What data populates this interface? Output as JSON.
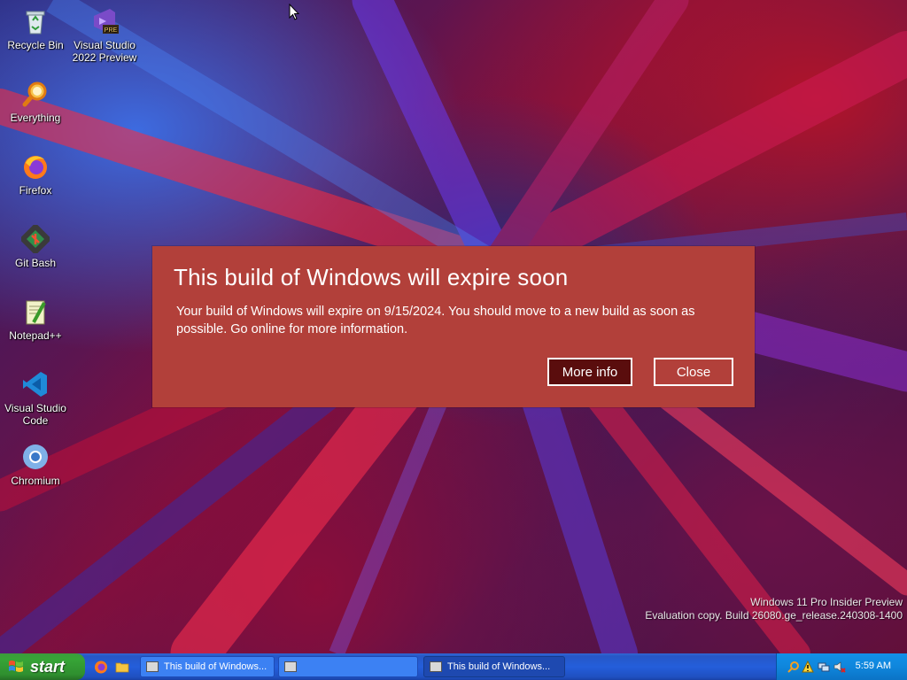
{
  "desktop": {
    "icons": [
      {
        "label": "Recycle Bin",
        "icon": "recycle-bin-icon"
      },
      {
        "label": "Visual Studio 2022 Preview",
        "icon": "visual-studio-preview-icon",
        "badge": "PRE"
      },
      {
        "label": "Everything",
        "icon": "everything-search-icon"
      },
      {
        "label": "Firefox",
        "icon": "firefox-icon"
      },
      {
        "label": "Git Bash",
        "icon": "git-bash-icon"
      },
      {
        "label": "Notepad++",
        "icon": "notepad-plus-plus-icon"
      },
      {
        "label": "Visual Studio Code",
        "icon": "vscode-icon"
      },
      {
        "label": "Chromium",
        "icon": "chromium-icon"
      }
    ],
    "watermark": {
      "line1": "Windows 11 Pro Insider Preview",
      "line2": "Evaluation copy. Build 26080.ge_release.240308-1400"
    }
  },
  "dialog": {
    "title": "This build of Windows will expire soon",
    "body": "Your build of Windows will expire on 9/15/2024. You should move to a new build as soon as possible. Go online for more information.",
    "primary_label": "More info",
    "secondary_label": "Close",
    "background_color": "#b2403a"
  },
  "taskbar": {
    "start_label": "start",
    "quick_launch": [
      "firefox-icon",
      "folder-icon"
    ],
    "tasks": [
      {
        "label": "This build of Windows...",
        "active": false
      },
      {
        "label": "",
        "active": false
      },
      {
        "label": "This build of Windows...",
        "active": true
      }
    ],
    "tray_icons": [
      "search-icon",
      "warning-icon",
      "network-icon",
      "volume-muted-icon"
    ],
    "clock": "5:59 AM"
  }
}
